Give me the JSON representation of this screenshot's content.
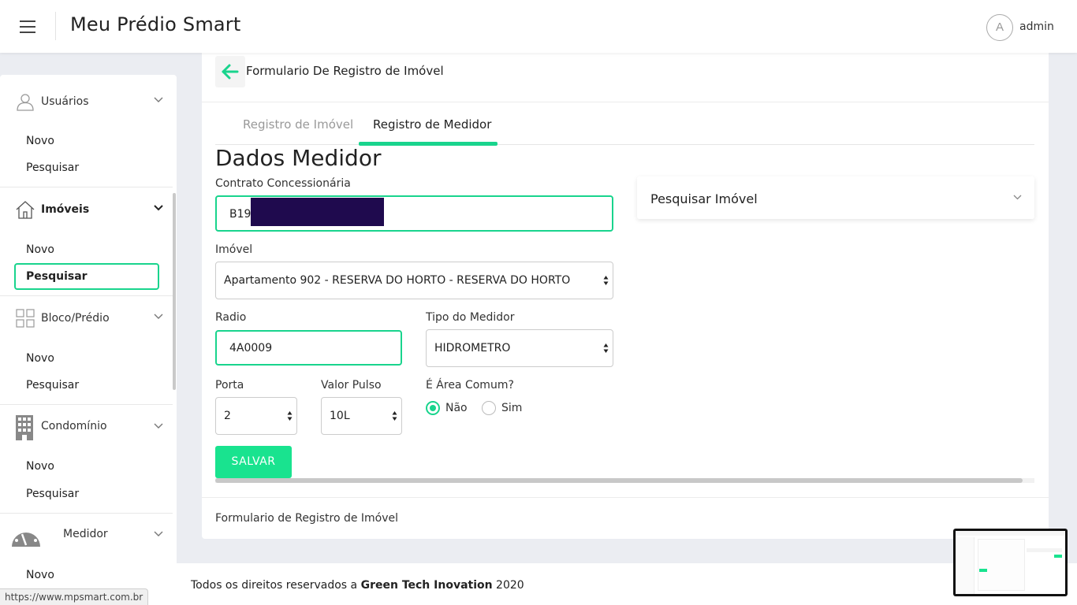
{
  "header": {
    "title": "Meu Prédio Smart",
    "avatar_initial": "A",
    "username": "admin"
  },
  "sidebar": {
    "groups": [
      {
        "label": "Usuários",
        "icon": "user-icon",
        "items": [
          "Novo",
          "Pesquisar"
        ]
      },
      {
        "label": "Imóveis",
        "icon": "house-icon",
        "items": [
          "Novo",
          "Pesquisar"
        ],
        "active_item": "Pesquisar"
      },
      {
        "label": "Bloco/Prédio",
        "icon": "grid-icon",
        "items": [
          "Novo",
          "Pesquisar"
        ]
      },
      {
        "label": "Condomínio",
        "icon": "building-icon",
        "items": [
          "Novo",
          "Pesquisar"
        ]
      },
      {
        "label": "Medidor",
        "icon": "gauge-icon",
        "items": [
          "Novo"
        ]
      }
    ]
  },
  "card": {
    "title": "Formulario De Registro de Imóvel",
    "tabs": [
      {
        "label": "Registro de Imóvel"
      },
      {
        "label": "Registro de Medidor"
      }
    ],
    "active_tab": "Registro de Medidor",
    "section_title": "Dados Medidor",
    "footer": "Formulario de Registro de Imóvel"
  },
  "form": {
    "contrato_label": "Contrato Concessionária",
    "contrato_value": "B192",
    "imovel_label": "Imóvel",
    "imovel_value": "Apartamento 902 - RESERVA DO HORTO - RESERVA DO HORTO",
    "radio_label": "Radio",
    "radio_value": "4A0009",
    "tipo_label": "Tipo do Medidor",
    "tipo_value": "HIDROMETRO",
    "porta_label": "Porta",
    "porta_value": "2",
    "pulso_label": "Valor Pulso",
    "pulso_value": "10L",
    "area_label": "É Área Comum?",
    "area_options": [
      "Não",
      "Sim"
    ],
    "area_selected": "Não",
    "save_label": "SALVAR"
  },
  "search_panel": {
    "label": "Pesquisar Imóvel"
  },
  "footer": {
    "prefix": "Todos os direitos reservados a ",
    "company": "Green Tech Inovation",
    "year": " 2020"
  },
  "status_url": "https://www.mpsmart.com.br",
  "colors": {
    "accent": "#19d48d",
    "button": "#19e38f",
    "redaction": "#1f0a4e"
  }
}
